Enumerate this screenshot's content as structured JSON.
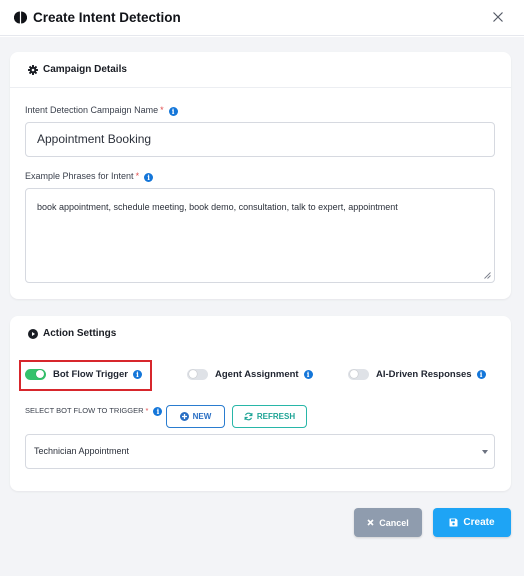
{
  "modal": {
    "title": "Create Intent Detection",
    "title_icon": "half-circle-icon",
    "close_icon": "close-icon"
  },
  "campaign_details": {
    "heading": "Campaign Details",
    "heading_icon": "gear-icon",
    "name_label": "Intent Detection Campaign Name",
    "name_required": "*",
    "name_value": "Appointment Booking",
    "phrases_label": "Example Phrases for Intent",
    "phrases_required": "*",
    "phrases_value": "book appointment, schedule meeting, book demo, consultation, talk to expert, appointment"
  },
  "action_settings": {
    "heading": "Action Settings",
    "heading_icon": "play-circle-icon",
    "toggles": [
      {
        "label": "Bot Flow Trigger",
        "on": true
      },
      {
        "label": "Agent Assignment",
        "on": false
      },
      {
        "label": "AI-Driven Responses",
        "on": false
      }
    ],
    "bot_flow_label": "SELECT BOT FLOW TO TRIGGER",
    "bot_flow_required": "*",
    "new_button": "NEW",
    "refresh_button": "REFRESH",
    "bot_flow_selected": "Technician Appointment"
  },
  "footer": {
    "cancel": "Cancel",
    "create": "Create"
  },
  "colors": {
    "primary": "#1ea4f5",
    "toggle_on": "#34c26b",
    "cancel": "#8f9cae",
    "highlight": "#d7262c",
    "info": "#1476d9"
  }
}
